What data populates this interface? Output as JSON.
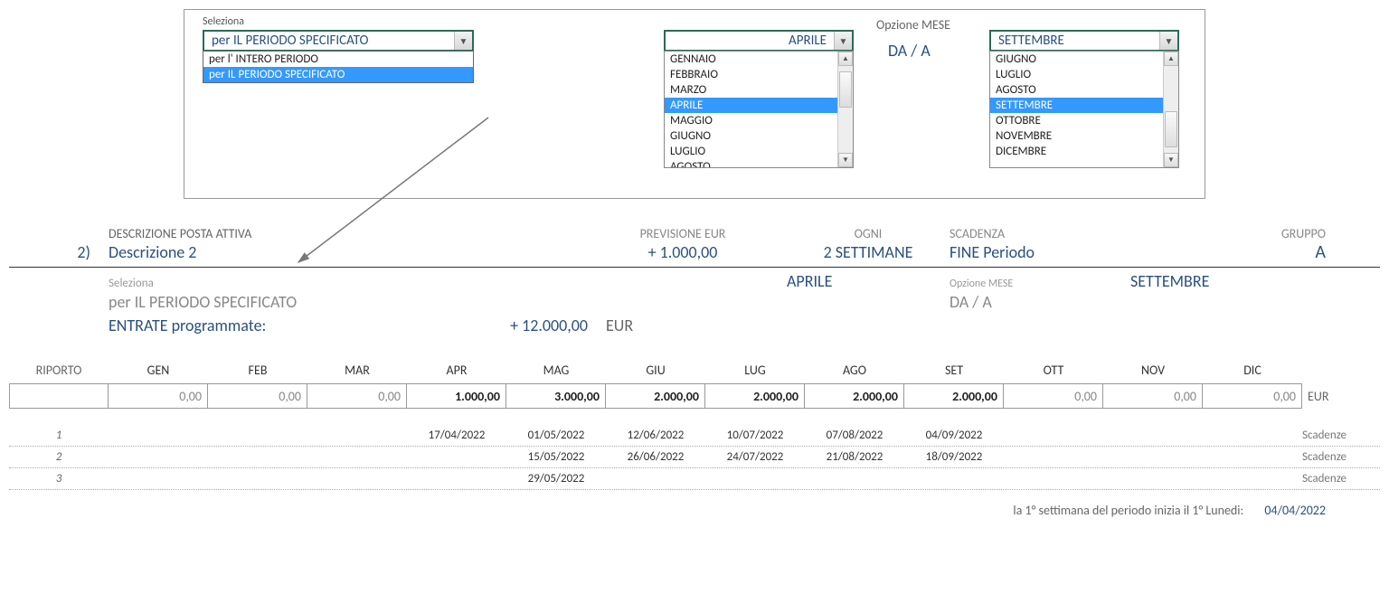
{
  "topPanel": {
    "selezionaLabel": "Seleziona",
    "periodCombo": {
      "value": "per IL PERIODO SPECIFICATO",
      "options": [
        "per l' INTERO PERIODO",
        "per IL PERIODO SPECIFICATO"
      ],
      "selectedIndex": 1
    },
    "opzioneMeseLabel": "Opzione MESE",
    "daALabel": "DA  / A",
    "monthFrom": {
      "value": "APRILE",
      "options": [
        "GENNAIO",
        "FEBBRAIO",
        "MARZO",
        "APRILE",
        "MAGGIO",
        "GIUGNO",
        "LUGLIO",
        "AGOSTO"
      ],
      "selectedIndex": 3
    },
    "monthTo": {
      "value": "SETTEMBRE",
      "options": [
        "GIUGNO",
        "LUGLIO",
        "AGOSTO",
        "SETTEMBRE",
        "OTTOBRE",
        "NOVEMBRE",
        "DICEMBRE"
      ],
      "selectedIndex": 3
    }
  },
  "entry": {
    "index": "2)",
    "headers": {
      "desc": "DESCRIZIONE POSTA ATTIVA",
      "prev": "PREVISIONE EUR",
      "ogni": "OGNI",
      "scad": "SCADENZA",
      "gruppo": "GRUPPO"
    },
    "values": {
      "desc": "Descrizione 2",
      "prev": "+ 1.000,00",
      "ogni": "2 SETTIMANE",
      "scad": "FINE Periodo",
      "gruppo": "A"
    },
    "selezionaLabel": "Seleziona",
    "periodText": "per IL PERIODO SPECIFICATO",
    "monthFrom": "APRILE",
    "opzioneMese": "Opzione MESE",
    "daA": "DA  / A",
    "monthTo": "SETTEMBRE",
    "entrateLabel": "ENTRATE programmate:",
    "entrateValue": "+ 12.000,00",
    "entrateCurrency": "EUR"
  },
  "grid": {
    "riportoLabel": "RIPORTO",
    "months": [
      "GEN",
      "FEB",
      "MAR",
      "APR",
      "MAG",
      "GIU",
      "LUG",
      "AGO",
      "SET",
      "OTT",
      "NOV",
      "DIC"
    ],
    "currency": "EUR",
    "riportoValue": "",
    "values": [
      "0,00",
      "0,00",
      "0,00",
      "1.000,00",
      "3.000,00",
      "2.000,00",
      "2.000,00",
      "2.000,00",
      "2.000,00",
      "0,00",
      "0,00",
      "0,00"
    ],
    "bold": [
      false,
      false,
      false,
      true,
      true,
      true,
      true,
      true,
      true,
      false,
      false,
      false
    ]
  },
  "dateRows": [
    {
      "idx": "1",
      "label": "Scadenze",
      "cells": [
        "",
        "",
        "",
        "17/04/2022",
        "01/05/2022",
        "12/06/2022",
        "10/07/2022",
        "07/08/2022",
        "04/09/2022",
        "",
        "",
        ""
      ]
    },
    {
      "idx": "2",
      "label": "Scadenze",
      "cells": [
        "",
        "",
        "",
        "",
        "15/05/2022",
        "26/06/2022",
        "24/07/2022",
        "21/08/2022",
        "18/09/2022",
        "",
        "",
        ""
      ]
    },
    {
      "idx": "3",
      "label": "Scadenze",
      "cells": [
        "",
        "",
        "",
        "",
        "29/05/2022",
        "",
        "",
        "",
        "",
        "",
        "",
        ""
      ]
    }
  ],
  "footer": {
    "text": "la 1° settimana del periodo inizia il 1° Lunedi:",
    "date": "04/04/2022"
  }
}
